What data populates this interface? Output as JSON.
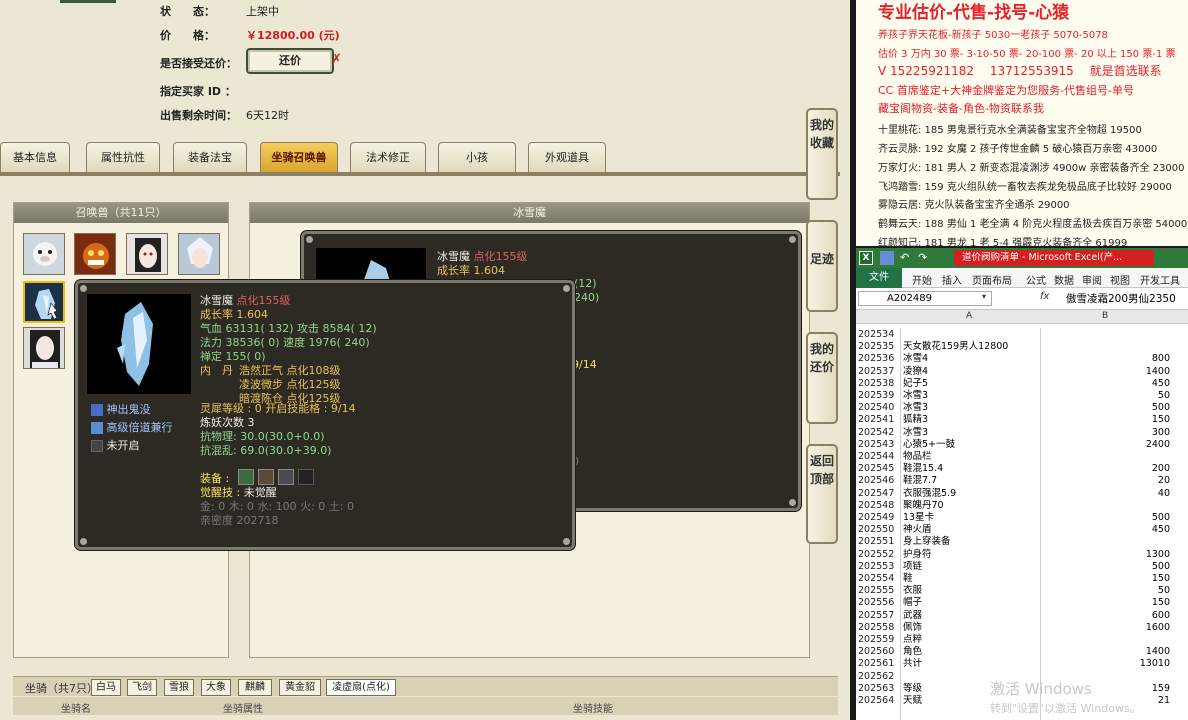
{
  "trade": {
    "status_label": "状　　态：",
    "status_value": "上架中",
    "price_label": "价　　格：",
    "price_value": "￥12800.00 (元)",
    "counter_label": "是否接受还价：",
    "counter_button": "还价",
    "counter_x": "✗",
    "buyer_label": "指定买家 ID ：",
    "remaining_label": "出售剩余时间：",
    "remaining_value": "6天12时"
  },
  "tabs": [
    "基本信息",
    "属性抗性",
    "装备法宝",
    "坐骑召唤兽",
    "法术修正",
    "小孩",
    "外观道具"
  ],
  "active_tab": "坐骑召唤兽",
  "pet_panel": {
    "title": "召唤兽（共11只）"
  },
  "detail_panel": {
    "title": "冰雪魔"
  },
  "tooltip_back": {
    "name": "冰雪魔",
    "upgrade": "点化155级",
    "growth": "成长率 1.604",
    "frag1": "(12)",
    "frag2": "240)",
    "frag3": "9/14",
    "frag4": "0"
  },
  "tooltip": {
    "name": "冰雪魔",
    "upgrade": "点化155级",
    "growth": "成长率 1.604",
    "hp": "气血 63131( 132) 攻击 8584( 12)",
    "mp": "法力 38536( 0) 速度 1976( 240)",
    "mind": "禅定 155( 0)",
    "neidan_label": "内　丹",
    "neidan1": "浩然正气 点化108级",
    "neidan2": "凌波微步 点化125级",
    "neidan3": "暗渡陈仓 点化125级",
    "skill1": "神出鬼没",
    "skill2": "高级倍道兼行",
    "skill3": "未开启",
    "lingxi": "灵犀等级 : 0 开启技能格 : 9/14",
    "lianyao": "炼妖次数 3",
    "kangwuli": "抗物理: 30.0(30.0+0.0)",
    "kanghunluan": "抗混乱: 69.0(30.0+39.0)",
    "equip_label": "装备 :",
    "awaken_label": "觉醒技 :",
    "awaken_value": "未觉醒",
    "elements": "金: 0 木: 0 水: 100 火: 0 土: 0",
    "intimacy": "亲密度 202718"
  },
  "side_buttons": [
    "我的收藏",
    "足迹",
    "我的还价",
    "返回顶部"
  ],
  "mount_bar": {
    "label": "坐骑（共7只）",
    "tabs": [
      "白马",
      "飞剑",
      "雪狼",
      "大象",
      "麒麟",
      "黄金貂",
      "凌虚扇(点化)"
    ],
    "col1": "坐骑名",
    "col2": "坐骑属性",
    "col3": "坐骑技能"
  },
  "ad": {
    "title": "专业估价-代售-找号-心猿",
    "lines": [
      "养孩子界天花板-新孩子 5030一老孩子 5070-5078",
      "估价 3 万内 30 票- 3-10-50 票- 20-100 票- 20 以上 150 票-1 票",
      "V 15225921182　 13712553915　 就是首选联系",
      "CC 首席鉴定+大神金牌鉴定为您服务-代售组号-单号",
      "藏宝阁物资-装备-角色-物资联系我",
      "十里桃花: 185 男鬼景行克水全满装备宝宝齐全物超 19500",
      "齐云灵脉: 192 女魔 2 孩子传世金麟 5 破心猿百万亲密 43000",
      "万家灯火: 181 男人 2 新变态混凌渊涉 4900w 亲密装备齐全 23000",
      "飞鸿踏雪: 159 克火组队统一畜牧去疾龙免极品底子比较好 29000",
      "雾隐云居: 克火队装备宝宝齐全通杀 29000",
      "鹤舞云天: 188 男仙 1 老全满 4 阶克火程度孟极去疾百万亲密 54000",
      "红颜知己: 181 男龙 1 老 5-4 强霹克火装备齐全 61999"
    ]
  },
  "excel": {
    "title": "道价阀购清单 - Microsoft Excel(产...",
    "menu": [
      "文件",
      "开始",
      "插入",
      "页面布局",
      "公式",
      "数据",
      "审阅",
      "视图",
      "开发工具"
    ],
    "namebox": "A202489",
    "formula_icon": "fx",
    "formula": "傲雪凌霜200男仙2350",
    "col_a": "A",
    "col_b": "B",
    "rows": [
      [
        "202534",
        "",
        ""
      ],
      [
        "202535",
        "天女散花159男人12800",
        ""
      ],
      [
        "202536",
        "冰雪4",
        "800"
      ],
      [
        "202537",
        "凌獠4",
        "1400"
      ],
      [
        "202538",
        "妃子5",
        "450"
      ],
      [
        "202539",
        "冰雪3",
        "50"
      ],
      [
        "202540",
        "冰雪3",
        "500"
      ],
      [
        "202541",
        "狐精3",
        "150"
      ],
      [
        "202542",
        "冰雪3",
        "300"
      ],
      [
        "202543",
        "心猿5+一鼓",
        "2400"
      ],
      [
        "202544",
        "物品栏",
        ""
      ],
      [
        "202545",
        "鞋混15.4",
        "200"
      ],
      [
        "202546",
        "鞋混7.7",
        "20"
      ],
      [
        "202547",
        "衣服强混5.9",
        "40"
      ],
      [
        "202548",
        "聚魄丹70",
        ""
      ],
      [
        "202549",
        "13星卡",
        "500"
      ],
      [
        "202550",
        "神火盾",
        "450"
      ],
      [
        "202551",
        "身上穿装备",
        ""
      ],
      [
        "202552",
        "护身符",
        "1300"
      ],
      [
        "202553",
        "项链",
        "500"
      ],
      [
        "202554",
        "鞋",
        "150"
      ],
      [
        "202555",
        "衣服",
        "50"
      ],
      [
        "202556",
        "帽子",
        "150"
      ],
      [
        "202557",
        "武器",
        "600"
      ],
      [
        "202558",
        "佩饰",
        "1600"
      ],
      [
        "202559",
        "点粹",
        ""
      ],
      [
        "202560",
        "角色",
        "1400"
      ],
      [
        "202561",
        "共计",
        "13010"
      ],
      [
        "202562",
        "",
        ""
      ],
      [
        "202563",
        "等级",
        "159"
      ],
      [
        "202564",
        "天赋",
        "21"
      ]
    ]
  },
  "watermark": {
    "line1": "激活 Windows",
    "line2": "转到\"设置\"以激活 Windows。"
  },
  "colors": {
    "active_tab": "#f5ce5b",
    "price_red": "#d21c1c",
    "excel_green": "#2f7a3a",
    "ad_red": "#e8202a",
    "tooltip_bg": "#2c2a23"
  }
}
